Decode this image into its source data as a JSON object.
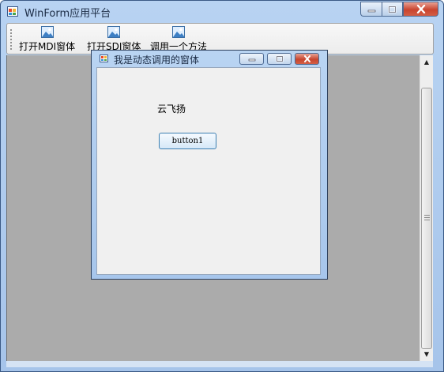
{
  "window": {
    "title": "WinForm应用平台"
  },
  "toolbar": {
    "items": [
      {
        "label": "打开MDI窗体",
        "icon": "image-icon"
      },
      {
        "label": "打开SDI窗体",
        "icon": "image-icon"
      },
      {
        "label": "调用一个方法",
        "icon": "image-icon"
      }
    ]
  },
  "child_window": {
    "title": "我是动态调用的窗体",
    "label_text": "云飞扬",
    "button_label": "button1"
  },
  "colors": {
    "mdi_background": "#ababab",
    "titlebar": "#b8d3f2",
    "close_button": "#c9452f",
    "form_background": "#f0f0f0"
  }
}
